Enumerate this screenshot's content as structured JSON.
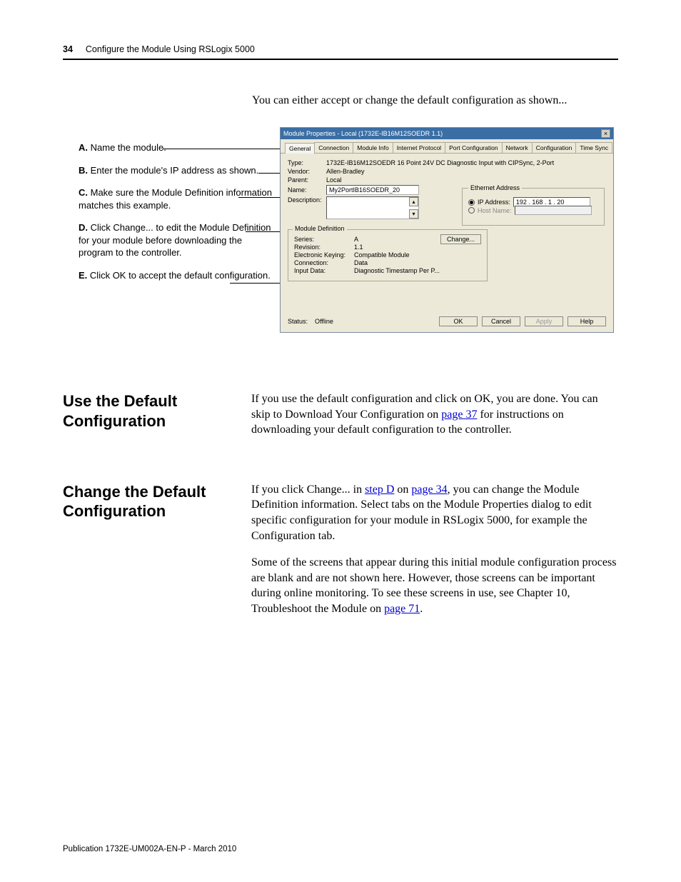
{
  "header": {
    "page_number": "34",
    "chapter_title": "Configure the Module Using RSLogix 5000"
  },
  "intro": "You can either accept or change the default configuration as shown...",
  "callouts": {
    "a": {
      "letter": "A.",
      "text": "Name the module."
    },
    "b": {
      "letter": "B.",
      "text": "Enter the module's IP address as shown."
    },
    "c": {
      "letter": "C.",
      "text": "Make sure the Module Definition information matches this example."
    },
    "d": {
      "letter": "D.",
      "text": "Click Change... to edit the Module Definition for your module before downloading the program to the controller."
    },
    "e": {
      "letter": "E.",
      "text": "Click OK to accept the default configuration."
    }
  },
  "dialog": {
    "title": "Module Properties - Local (1732E-IB16M12SOEDR  1.1)",
    "tabs": [
      "General",
      "Connection",
      "Module Info",
      "Internet Protocol",
      "Port Configuration",
      "Network",
      "Configuration",
      "Time Sync"
    ],
    "fields": {
      "type_label": "Type:",
      "type_value": "1732E-IB16M12SOEDR 16 Point 24V DC Diagnostic Input with CIPSync, 2-Port",
      "vendor_label": "Vendor:",
      "vendor_value": "Allen-Bradley",
      "parent_label": "Parent:",
      "parent_value": "Local",
      "name_label": "Name:",
      "name_value": "My2PortIB16SOEDR_20",
      "desc_label": "Description:"
    },
    "ethernet": {
      "group_label": "Ethernet Address",
      "ip_label": "IP Address:",
      "ip_value": "192 . 168 .   1  .  20",
      "hostname_label": "Host Name:"
    },
    "module_def": {
      "group_label": "Module Definition",
      "change_btn": "Change...",
      "rows": {
        "series": {
          "label": "Series:",
          "value": "A"
        },
        "revision": {
          "label": "Revision:",
          "value": "1.1"
        },
        "keying": {
          "label": "Electronic Keying:",
          "value": "Compatible Module"
        },
        "connection": {
          "label": "Connection:",
          "value": "Data"
        },
        "input": {
          "label": "Input Data:",
          "value": "Diagnostic Timestamp Per P..."
        }
      }
    },
    "footer": {
      "status_label": "Status:",
      "status_value": "Offline",
      "ok": "OK",
      "cancel": "Cancel",
      "apply": "Apply",
      "help": "Help"
    }
  },
  "sections": {
    "use_default": {
      "heading": "Use the Default Configuration",
      "body_pre": "If you use the default configuration and click on OK, you are done. You can skip to Download Your Configuration on ",
      "link": "page 37",
      "body_post": " for instructions on downloading your default configuration to the controller."
    },
    "change_default": {
      "heading": "Change the Default Configuration",
      "p1_a": "If you click Change... in ",
      "p1_link1": "step D",
      "p1_b": " on ",
      "p1_link2": "page 34",
      "p1_c": ", you can change the Module Definition information. Select tabs on the Module Properties dialog to edit specific configuration for your module in RSLogix 5000, for example the Configuration tab.",
      "p2_a": "Some of the screens that appear during this initial module configuration process are blank and are not shown here. However, those screens can be important during online monitoring. To see these screens in use, see Chapter 10, Troubleshoot the Module on ",
      "p2_link": "page 71",
      "p2_b": "."
    }
  },
  "footer_pub": "Publication 1732E-UM002A-EN-P - March 2010"
}
